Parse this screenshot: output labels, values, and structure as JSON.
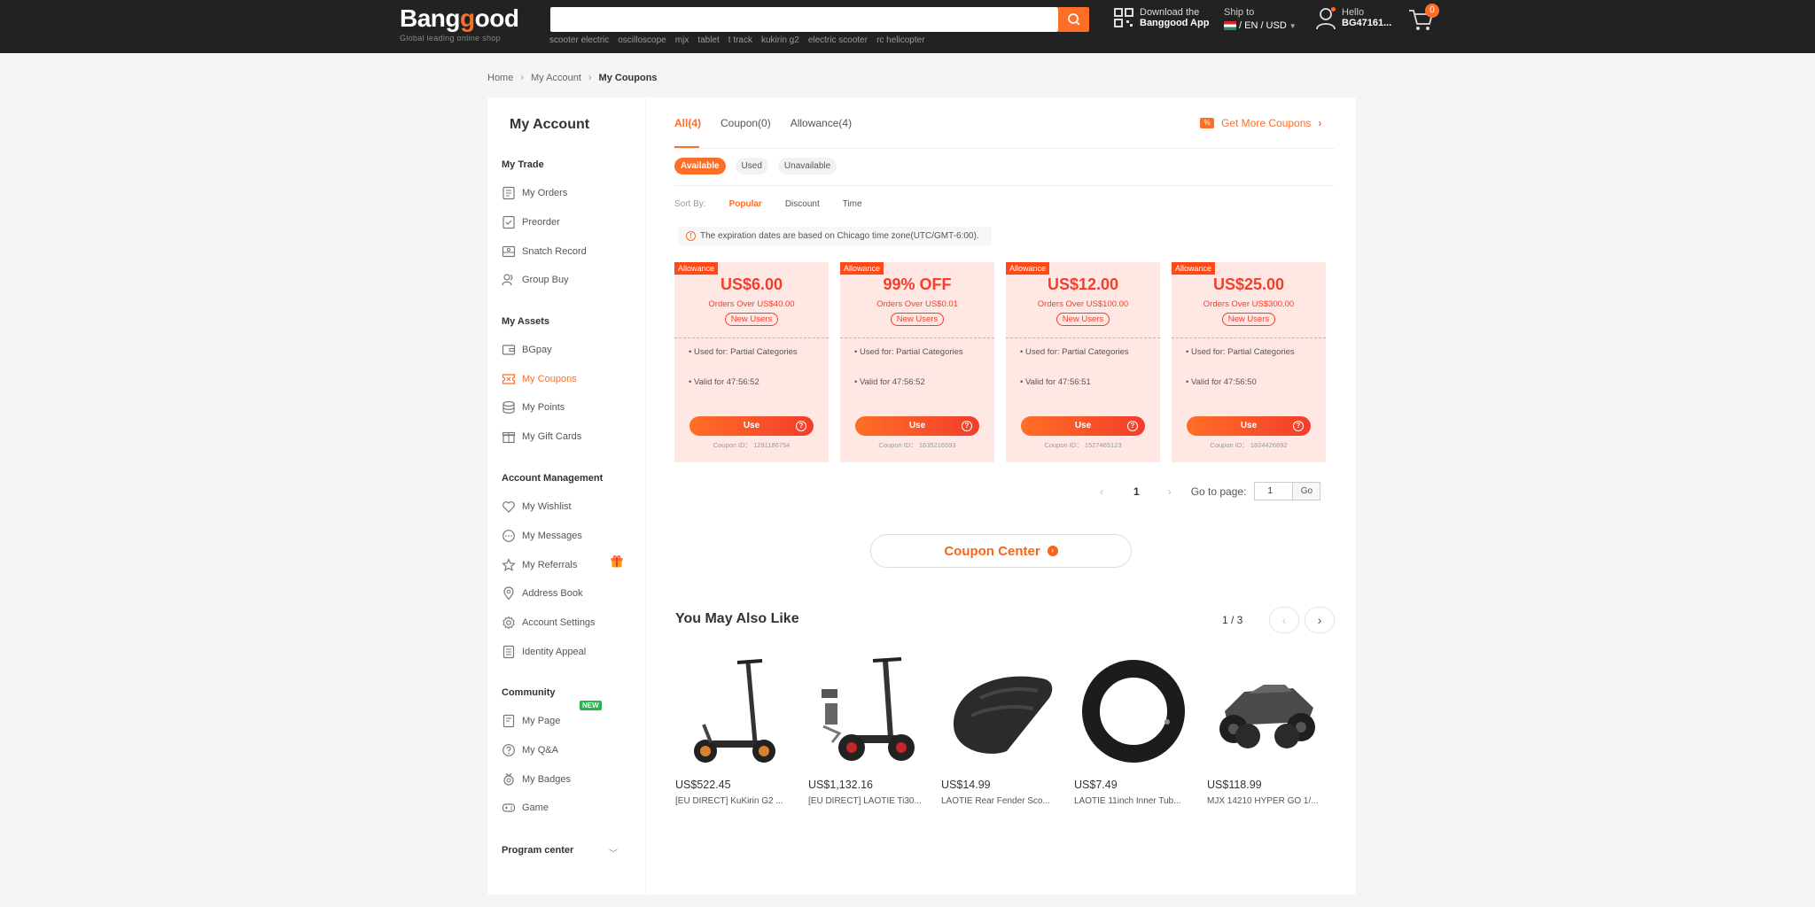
{
  "header": {
    "logo_text_a": "Bang",
    "logo_text_b": "g",
    "logo_text_c": "ood",
    "logo_sub": "Global leading online shop",
    "search_placeholder": "",
    "hot_words": [
      "scooter electric",
      "oscilloscope",
      "mjx",
      "tablet",
      "t track",
      "kukirin g2",
      "electric scooter",
      "rc helicopter"
    ],
    "app_line1": "Download the",
    "app_line2": "Banggood App",
    "ship_to": "Ship to",
    "locale": "/ EN / USD",
    "hello": "Hello",
    "username": "BG47161...",
    "cart_count": "0",
    "accent_color": "#ff6e26"
  },
  "breadcrumb": [
    "Home",
    "My Account",
    "My Coupons"
  ],
  "sidebar": {
    "title": "My Account",
    "sections": {
      "trade": "My Trade",
      "assets": "My Assets",
      "account": "Account Management",
      "community": "Community",
      "program": "Program center"
    },
    "items": {
      "orders": "My Orders",
      "preorder": "Preorder",
      "snatch": "Snatch Record",
      "groupbuy": "Group Buy",
      "bgpay": "BGpay",
      "coupons": "My Coupons",
      "points": "My Points",
      "giftcards": "My Gift Cards",
      "wishlist": "My Wishlist",
      "messages": "My Messages",
      "referrals": "My Referrals",
      "address": "Address Book",
      "settings": "Account Settings",
      "identity": "Identity Appeal",
      "mypage": "My Page",
      "qa": "My Q&A",
      "badges": "My Badges",
      "game": "Game"
    },
    "new_badge": "NEW"
  },
  "main": {
    "tabs": [
      "All(4)",
      "Coupon(0)",
      "Allowance(4)"
    ],
    "get_more": "Get More Coupons",
    "get_more_icon_text": "%",
    "filters": [
      "Available",
      "Used",
      "Unavailable"
    ],
    "sort_label": "Sort By:",
    "sort_options": [
      "Popular",
      "Discount",
      "Time"
    ],
    "tz_note": "The expiration dates are based on Chicago time zone(UTC/GMT-6:00).",
    "tz_icon": "!",
    "coupons": [
      {
        "tag": "Allowance",
        "amount": "US$6.00",
        "cond": "Orders Over US$40.00",
        "badge": "New Users",
        "use_for": "Used for: Partial Categories",
        "valid": "Valid for 47:56:52",
        "btn": "Use",
        "id": "Coupon ID： 1291186754"
      },
      {
        "tag": "Allowance",
        "amount": "99% OFF",
        "cond": "Orders Over US$0.01",
        "badge": "New Users",
        "use_for": "Used for: Partial Categories",
        "valid": "Valid for 47:56:52",
        "btn": "Use",
        "id": "Coupon ID： 1635216593"
      },
      {
        "tag": "Allowance",
        "amount": "US$12.00",
        "cond": "Orders Over US$100.00",
        "badge": "New Users",
        "use_for": "Used for: Partial Categories",
        "valid": "Valid for 47:56:51",
        "btn": "Use",
        "id": "Coupon ID： 1527465123"
      },
      {
        "tag": "Allowance",
        "amount": "US$25.00",
        "cond": "Orders Over US$300.00",
        "badge": "New Users",
        "use_for": "Used for: Partial Categories",
        "valid": "Valid for 47:56:50",
        "btn": "Use",
        "id": "Coupon ID： 1824426892"
      }
    ],
    "pager": {
      "current": "1",
      "goto_label": "Go to page:",
      "input_value": "1",
      "go": "Go"
    },
    "coupon_center": "Coupon Center",
    "ymal_title": "You May Also Like",
    "ymal_count": "1 / 3",
    "products": [
      {
        "price": "US$522.45",
        "name": "[EU DIRECT] KuKirin G2 ..."
      },
      {
        "price": "US$1,132.16",
        "name": "[EU DIRECT] LAOTIE Ti30..."
      },
      {
        "price": "US$14.99",
        "name": "LAOTIE Rear Fender Sco..."
      },
      {
        "price": "US$7.49",
        "name": "LAOTIE 11inch Inner Tub..."
      },
      {
        "price": "US$118.99",
        "name": "MJX 14210 HYPER GO 1/..."
      }
    ]
  }
}
